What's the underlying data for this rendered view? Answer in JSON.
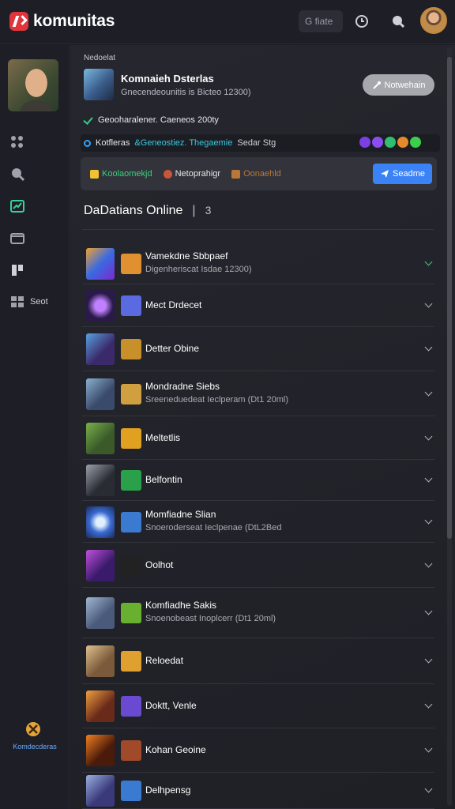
{
  "header": {
    "brand": "komunitas",
    "search_label": "G fiate"
  },
  "sidebar": {
    "items": [
      {
        "icon": "grid-dots-icon",
        "label": ""
      },
      {
        "icon": "search-icon",
        "label": ""
      },
      {
        "icon": "chart-icon",
        "label": ""
      },
      {
        "icon": "folder-icon",
        "label": ""
      },
      {
        "icon": "puzzle-icon",
        "label": ""
      },
      {
        "icon": "apps-icon",
        "label": "Seot"
      }
    ],
    "bottom_label": "Komdecderas"
  },
  "profile": {
    "caption": "Nedoelat",
    "title": "Komnaieh Dsterlas",
    "subtitle": "Gnecendeounitis is Bicteo 12300)",
    "action_label": "Notwehain"
  },
  "status": {
    "text": "Geooharalener. Caeneos 200ty"
  },
  "info_strip": {
    "part_a": "Kotfleras",
    "part_b": "&Geneostiez. Thegaemie",
    "part_c": "Sedar Stg",
    "badge_colors": [
      "#7b3fe4",
      "#8a4ef0",
      "#2fbf71",
      "#e58a2b",
      "#3ccf4e"
    ]
  },
  "toolbar": {
    "item1": "Koolaomekjd",
    "item2": "Netoprahigr",
    "item3": "Oonaehld",
    "button": "Seadme"
  },
  "section": {
    "title": "DaDatians Online",
    "count": "3"
  },
  "rows": [
    {
      "title": "Vamekdne Sbbpaef",
      "sub": "Digenheriscat Isdae 12300)",
      "expanded": true
    },
    {
      "title": "Mect Drdecet",
      "sub": "",
      "expanded": false
    },
    {
      "title": "Detter Obine",
      "sub": "",
      "expanded": false
    },
    {
      "title": "Mondradne Siebs",
      "sub": "Sreeneduedeat Ieclperam (Dt1 20ml)",
      "expanded": false
    },
    {
      "title": "Meltetlis",
      "sub": "",
      "expanded": false
    },
    {
      "title": "Belfontin",
      "sub": "",
      "expanded": false
    },
    {
      "title": "Momfiadne Slian",
      "sub": "Snoeroderseat Ieclpenae (DtL2Bed",
      "expanded": false
    },
    {
      "title": "Oolhot",
      "sub": "",
      "expanded": false
    },
    {
      "title": "Komfiadhe Sakis",
      "sub": "Snoenobeast Inoplcerr (Dt1 20ml)",
      "expanded": false
    },
    {
      "title": "Reloedat",
      "sub": "",
      "expanded": false
    },
    {
      "title": "Doktt, Venle",
      "sub": "",
      "expanded": false
    },
    {
      "title": "Kohan Geoine",
      "sub": "",
      "expanded": false
    },
    {
      "title": "Delhpensg",
      "sub": "",
      "expanded": false
    }
  ]
}
